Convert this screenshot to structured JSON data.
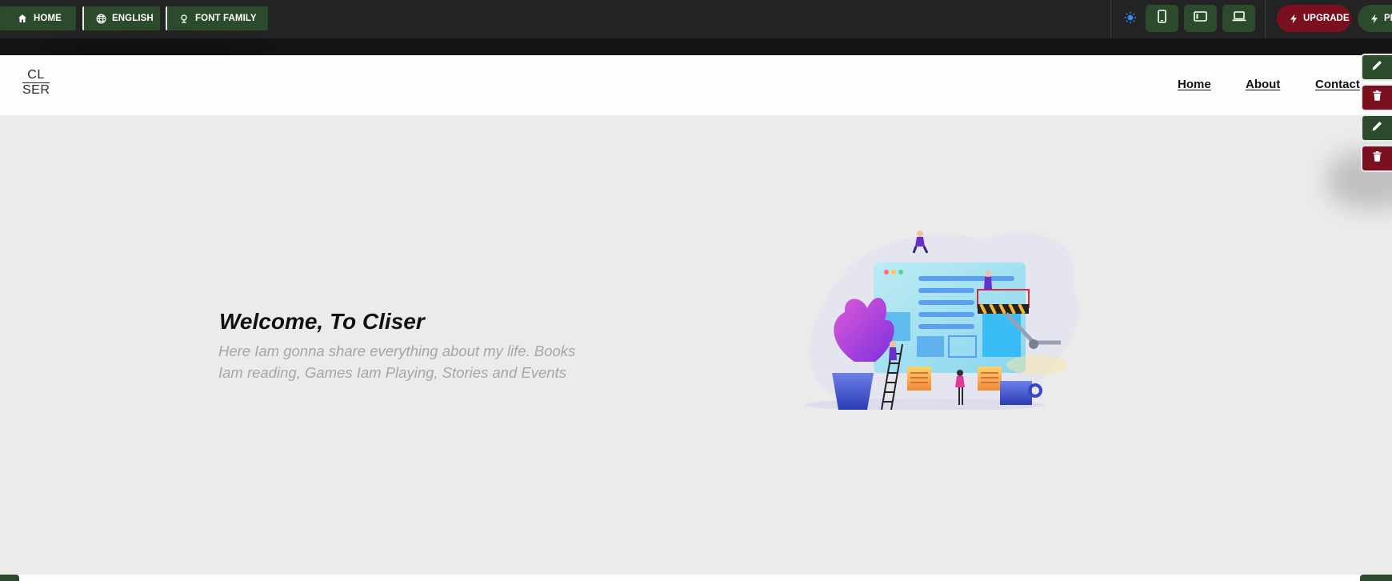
{
  "toolbar": {
    "home_label": "HOME",
    "language_label": "ENGLISH",
    "font_label": "FONT FAMILY",
    "upgrade_label": "UPGRADE",
    "pro_label": "PRO",
    "icons": {
      "home": "home-icon",
      "language": "globe-icon",
      "font": "font-icon",
      "theme": "sun-icon",
      "mobile": "mobile-icon",
      "tablet": "tablet-icon",
      "desktop": "laptop-icon",
      "bolt": "bolt-icon"
    }
  },
  "site": {
    "logo_line1": "CL",
    "logo_line2": "SER",
    "nav": {
      "home": "Home",
      "about": "About",
      "contact": "Contact"
    },
    "hero": {
      "title": "Welcome, To Cliser",
      "text": "Here Iam gonna share everything about my life. Books Iam reading, Games Iam Playing, Stories and Events"
    }
  },
  "colors": {
    "toolbar_bg": "#232323",
    "button_green": "#2c4a2c",
    "button_red": "#7a1020",
    "header_bg": "#fefefc",
    "hero_bg": "#ebebeb",
    "hero_text": "#a6a6a6"
  }
}
